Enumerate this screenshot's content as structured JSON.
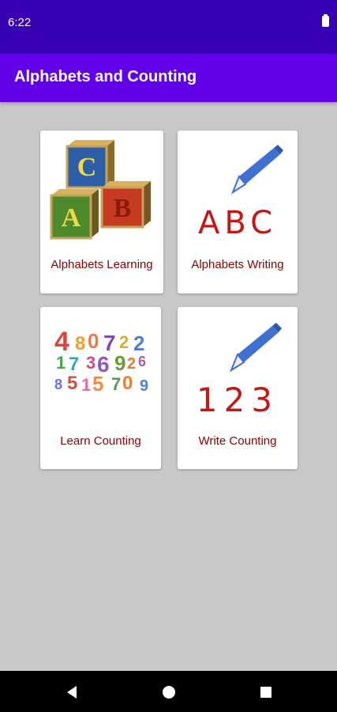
{
  "status_bar": {
    "time": "6:22"
  },
  "app_bar": {
    "title": "Alphabets and Counting"
  },
  "cards": [
    {
      "label": "Alphabets Learning",
      "icon": "abc-blocks-icon"
    },
    {
      "label": "Alphabets Writing",
      "icon": "pencil-abc-icon",
      "art_text": "ABC"
    },
    {
      "label": "Learn Counting",
      "icon": "colorful-numbers-icon"
    },
    {
      "label": "Write Counting",
      "icon": "pencil-123-icon",
      "art_text": "123"
    }
  ],
  "blocks": {
    "top": "C",
    "left": "A",
    "right": "B"
  },
  "colors": {
    "status_bar": "#3a00b3",
    "app_bar": "#6200ea",
    "background": "#c8c8c8",
    "label_text": "#8b0000",
    "pencil": "#3f6fd1",
    "letters": "#c21818"
  }
}
